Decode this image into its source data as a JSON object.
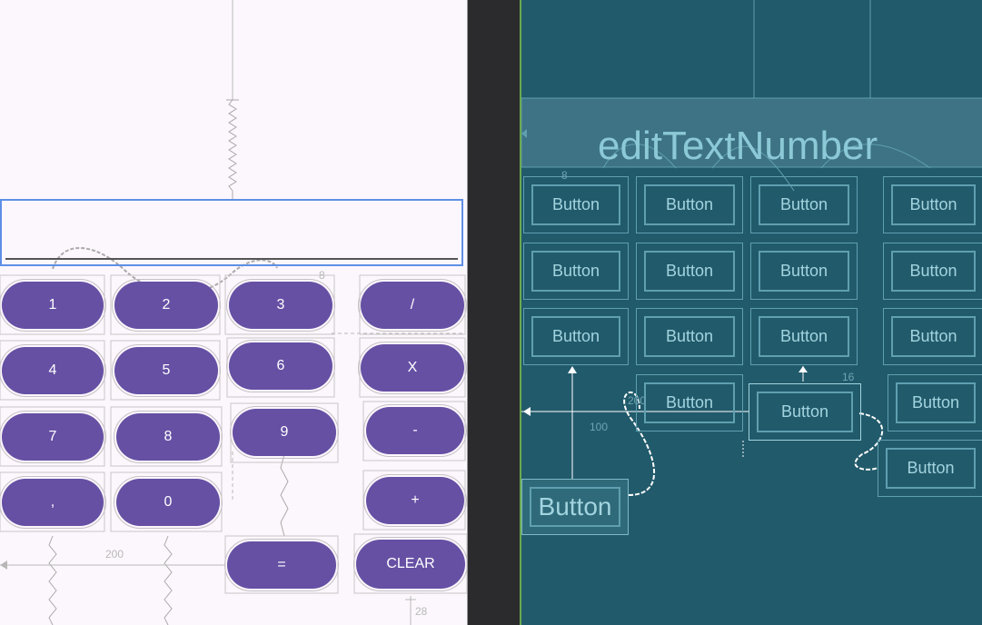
{
  "design": {
    "buttons": [
      {
        "key": "one",
        "label": "1"
      },
      {
        "key": "two",
        "label": "2"
      },
      {
        "key": "three",
        "label": "3"
      },
      {
        "key": "divide",
        "label": "/"
      },
      {
        "key": "four",
        "label": "4"
      },
      {
        "key": "five",
        "label": "5"
      },
      {
        "key": "six",
        "label": "6"
      },
      {
        "key": "multiply",
        "label": "X"
      },
      {
        "key": "seven",
        "label": "7"
      },
      {
        "key": "eight",
        "label": "8"
      },
      {
        "key": "nine",
        "label": "9"
      },
      {
        "key": "minus",
        "label": "-"
      },
      {
        "key": "comma",
        "label": ","
      },
      {
        "key": "zero",
        "label": "0"
      },
      {
        "key": "plus",
        "label": "+"
      },
      {
        "key": "equals",
        "label": "="
      },
      {
        "key": "clear",
        "label": "CLEAR"
      }
    ],
    "dims": {
      "margin_200": "200",
      "margin_8": "8",
      "margin_28": "28"
    }
  },
  "blueprint": {
    "title": "editTextNumber",
    "button_label": "Button",
    "large_button_label": "Button",
    "dims": {
      "d8": "8",
      "d16": "16",
      "d100": "100",
      "d200": "200"
    }
  },
  "colors": {
    "button": "#6650a4",
    "selection": "#5e8fe6",
    "blueprint_bg": "#215a6b",
    "blueprint_line": "#5f9fb0"
  }
}
